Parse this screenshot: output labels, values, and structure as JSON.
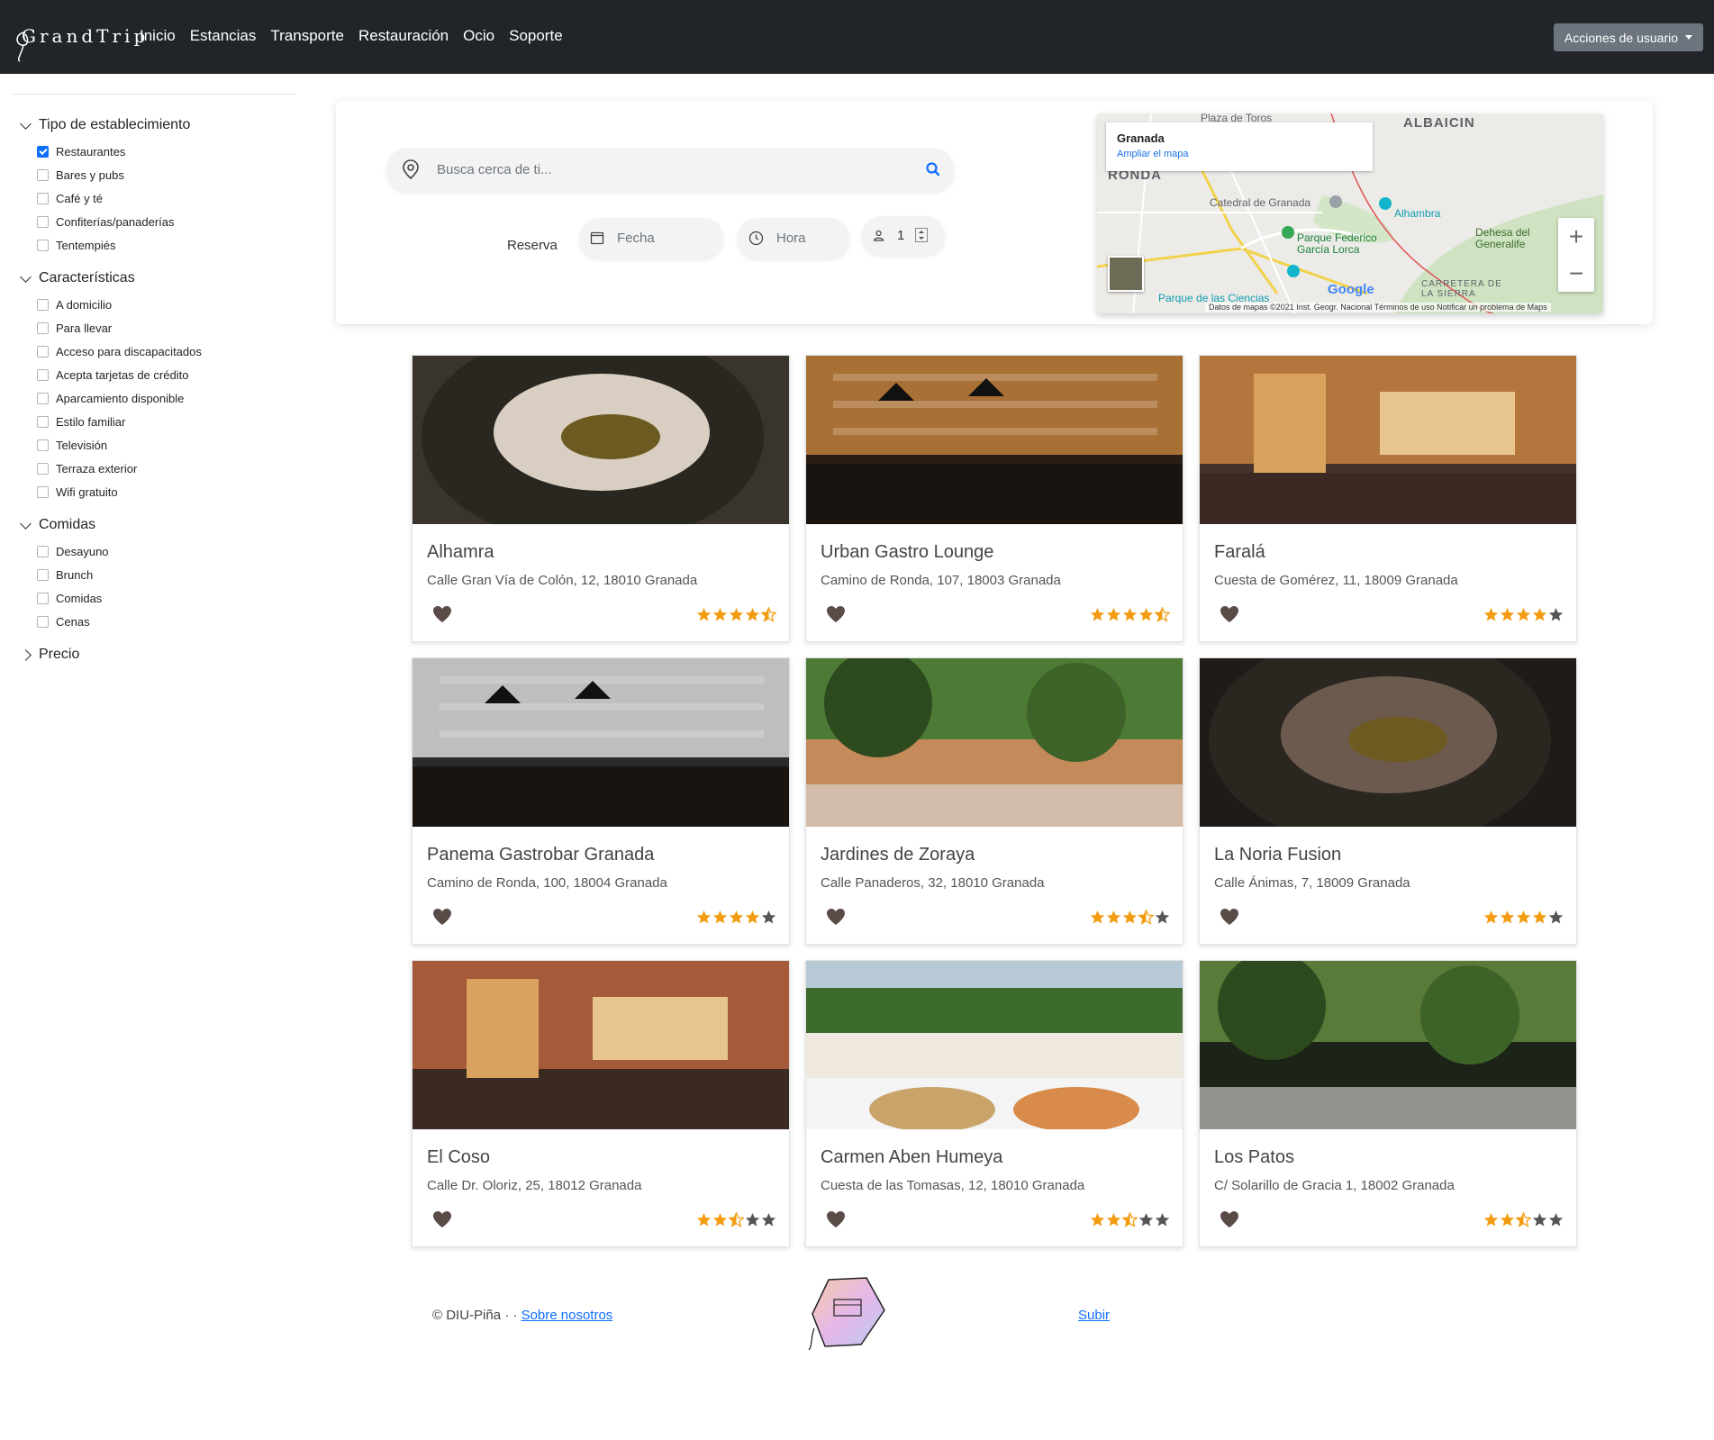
{
  "brand": "GrandTrip",
  "nav": [
    "Inicio",
    "Estancias",
    "Transporte",
    "Restauración",
    "Ocio",
    "Soporte"
  ],
  "user_menu": "Acciones de usuario",
  "filters": {
    "groups": [
      {
        "title": "Tipo de establecimiento",
        "open": true,
        "items": [
          {
            "label": "Restaurantes",
            "checked": true
          },
          {
            "label": "Bares y pubs",
            "checked": false
          },
          {
            "label": "Café y té",
            "checked": false
          },
          {
            "label": "Confiterías/panaderías",
            "checked": false
          },
          {
            "label": "Tentempiés",
            "checked": false
          }
        ]
      },
      {
        "title": "Características",
        "open": true,
        "items": [
          {
            "label": "A domicilio",
            "checked": false
          },
          {
            "label": "Para llevar",
            "checked": false
          },
          {
            "label": "Acceso para discapacitados",
            "checked": false
          },
          {
            "label": "Acepta tarjetas de crédito",
            "checked": false
          },
          {
            "label": "Aparcamiento disponible",
            "checked": false
          },
          {
            "label": "Estilo familiar",
            "checked": false
          },
          {
            "label": "Televisión",
            "checked": false
          },
          {
            "label": "Terraza exterior",
            "checked": false
          },
          {
            "label": "Wifi gratuito",
            "checked": false
          }
        ]
      },
      {
        "title": "Comidas",
        "open": true,
        "items": [
          {
            "label": "Desayuno",
            "checked": false
          },
          {
            "label": "Brunch",
            "checked": false
          },
          {
            "label": "Comidas",
            "checked": false
          },
          {
            "label": "Cenas",
            "checked": false
          }
        ]
      },
      {
        "title": "Precio",
        "open": false,
        "items": []
      }
    ]
  },
  "search": {
    "placeholder": "Busca cerca de ti...",
    "reserve_label": "Reserva",
    "date_placeholder": "Fecha",
    "time_placeholder": "Hora",
    "people": "1"
  },
  "map": {
    "info_title": "Granada",
    "info_link": "Ampliar el mapa",
    "labels": [
      "ALBAICIN",
      "RONDA",
      "Catedral de Granada",
      "Alhambra",
      "Parque Federico García Lorca",
      "Dehesa del Generalife",
      "Plaza de Toros",
      "CARRETERA DE LA SIERRA",
      "Parque de las Ciencias"
    ],
    "footer": "Datos de mapas ©2021 Inst. Geogr. Nacional   Términos de uso   Notificar un problema de Maps",
    "google": "Google"
  },
  "restaurants": [
    {
      "name": "Alhamra",
      "address": "Calle Gran Vía de Colón, 12, 18010 Granada",
      "rating": 4.5,
      "scene": "food",
      "c1": "#d8cfc2",
      "c2": "#3a352c"
    },
    {
      "name": "Urban Gastro Lounge",
      "address": "Camino de Ronda, 107, 18003 Granada",
      "rating": 4.5,
      "scene": "bar",
      "c1": "#c9863e",
      "c2": "#2a1d14"
    },
    {
      "name": "Faralá",
      "address": "Cuesta de Gomérez, 11, 18009 Granada",
      "rating": 4,
      "scene": "room",
      "c1": "#b3763c",
      "c2": "#45322a"
    },
    {
      "name": "Panema Gastrobar Granada",
      "address": "Camino de Ronda, 100, 18004 Granada",
      "rating": 4,
      "scene": "bar",
      "c1": "#e3e3e6",
      "c2": "#2b2b2e"
    },
    {
      "name": "Jardines de Zoraya",
      "address": "Calle Panaderos, 32, 18010 Granada",
      "rating": 3.5,
      "scene": "garden",
      "c1": "#4d7a35",
      "c2": "#c48a5a"
    },
    {
      "name": "La Noria Fusion",
      "address": "Calle Ánimas, 7, 18009 Granada",
      "rating": 4,
      "scene": "food",
      "c1": "#6d5a4e",
      "c2": "#1f1b19"
    },
    {
      "name": "El Coso",
      "address": "Calle Dr. Oloriz, 25, 18012 Granada",
      "rating": 2.5,
      "scene": "room",
      "c1": "#a55a3a",
      "c2": "#3a2a22"
    },
    {
      "name": "Carmen Aben Humeya",
      "address": "Cuesta de las Tomasas, 12, 18010 Granada",
      "rating": 2.5,
      "scene": "view",
      "c1": "#b8c9d6",
      "c2": "#3d6a2d"
    },
    {
      "name": "Los Patos",
      "address": "C/ Solarillo de Gracia 1, 18002 Granada",
      "rating": 2.5,
      "scene": "garden",
      "c1": "#5a7a3a",
      "c2": "#1c2418"
    }
  ],
  "footer": {
    "copyright": "© DIU-Piña · ·",
    "about": "Sobre nosotros",
    "up": "Subir"
  },
  "colors": {
    "navbar": "#212529",
    "accent": "#0d6efd",
    "star": "#f39c12",
    "star_empty": "#555555",
    "heart": "#5a4a48"
  }
}
